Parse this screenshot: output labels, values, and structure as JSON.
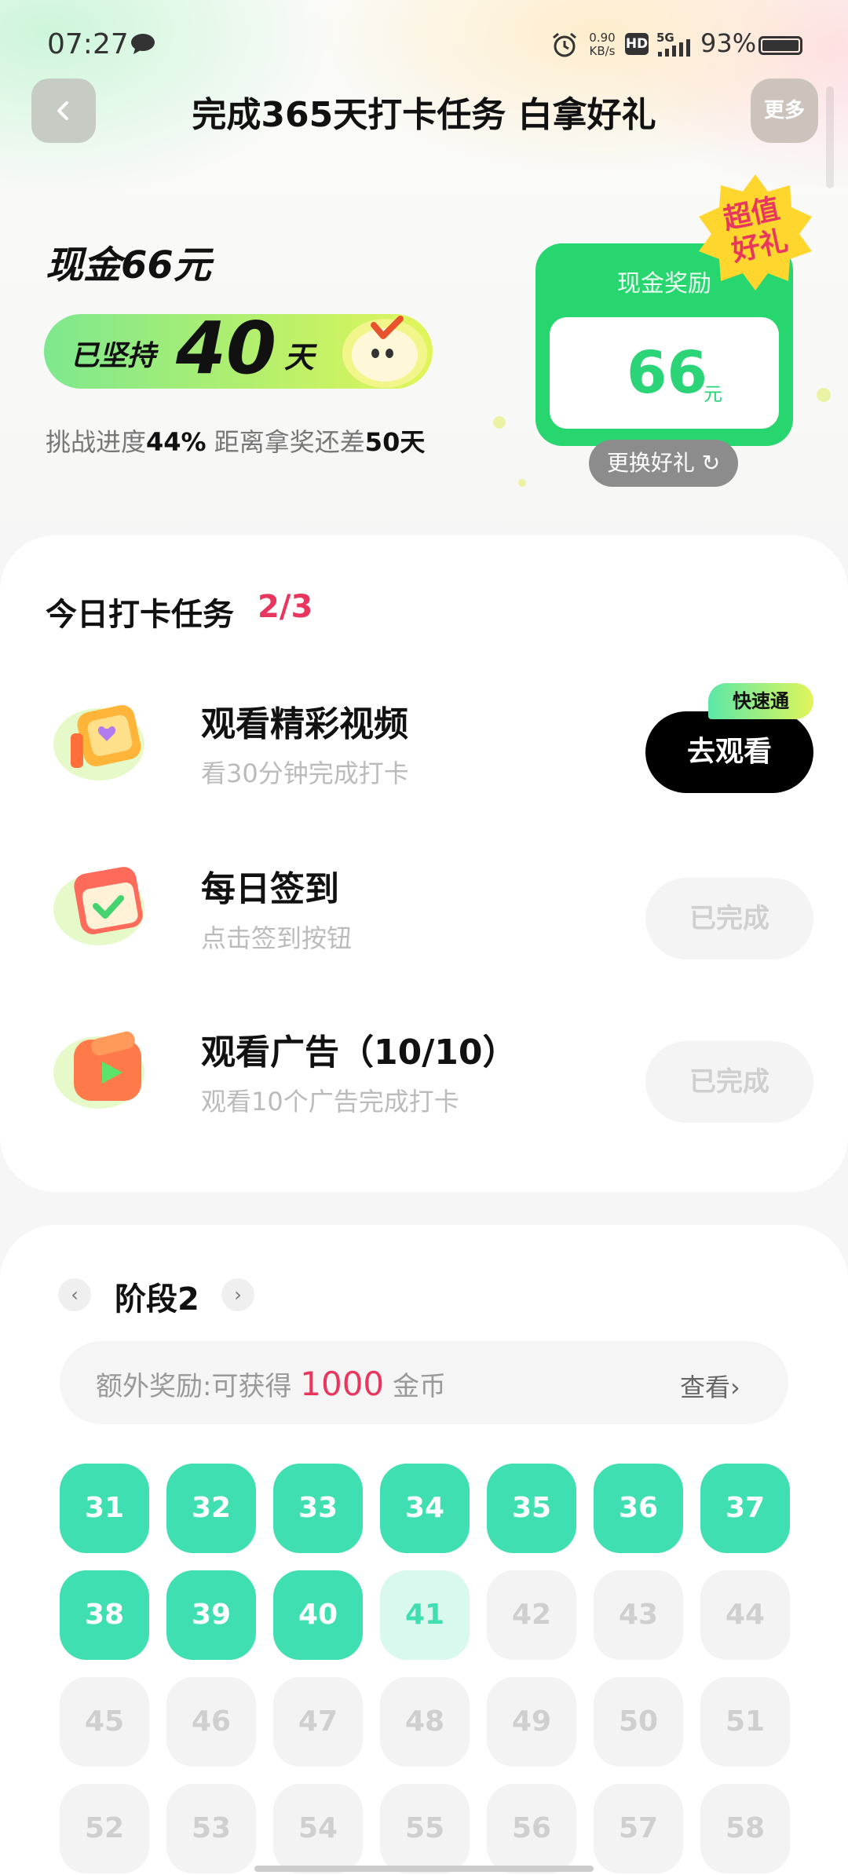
{
  "status_bar": {
    "time": "07:27",
    "net_speed": "0.90",
    "net_unit": "KB/s",
    "hd_label": "HD",
    "signal_label": "5G",
    "battery": "93%"
  },
  "header": {
    "title": "完成365天打卡任务 白拿好礼",
    "more_label": "更多"
  },
  "summary": {
    "cash_title": "现金66元",
    "streak_label": "已坚持",
    "streak_days": "40",
    "streak_unit": "天",
    "progress_prefix": "挑战进度",
    "progress_pct": "44%",
    "progress_mid": " 距离拿奖还差",
    "remaining_days": "50天"
  },
  "reward_card": {
    "label": "现金奖励",
    "amount": "66",
    "unit": "元",
    "badge_line1": "超值",
    "badge_line2": "好礼",
    "swap_label": "更换好礼 ↻"
  },
  "tasks": {
    "heading": "今日打卡任务",
    "count": "2/3",
    "items": [
      {
        "title": "观看精彩视频",
        "subtitle": "看30分钟完成打卡",
        "button": "去观看",
        "badge": "快速通"
      },
      {
        "title": "每日签到",
        "subtitle": "点击签到按钮",
        "button": "已完成"
      },
      {
        "title": "观看广告（10/10）",
        "subtitle": "观看10个广告完成打卡",
        "button": "已完成"
      }
    ]
  },
  "stage": {
    "title": "阶段2",
    "prev": "‹",
    "next": "›",
    "bonus_prefix": "额外奖励:可获得 ",
    "bonus_amount": "1000",
    "bonus_suffix": " 金币",
    "bonus_link": "查看›",
    "days": [
      "31",
      "32",
      "33",
      "34",
      "35",
      "36",
      "37",
      "38",
      "39",
      "40",
      "41",
      "42",
      "43",
      "44",
      "45",
      "46",
      "47",
      "48",
      "49",
      "50",
      "51",
      "52",
      "53",
      "54",
      "55",
      "56",
      "57",
      "58"
    ],
    "completed_through": "40",
    "today": "41"
  },
  "colors": {
    "accent_green": "#27d66e",
    "mint": "#40dfb1",
    "pink": "#e8365e"
  }
}
